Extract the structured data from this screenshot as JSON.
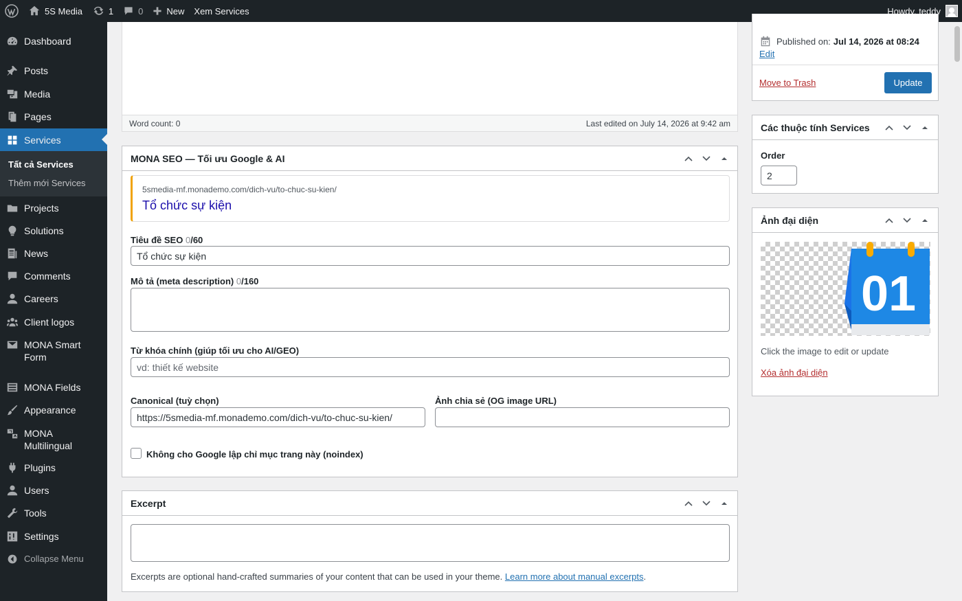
{
  "adminbar": {
    "site_name": "5S Media",
    "updates_count": "1",
    "comments_count": "0",
    "new_label": "New",
    "view_label": "Xem Services",
    "howdy": "Howdy, teddy"
  },
  "sidebar": {
    "items": [
      {
        "label": "Dashboard",
        "icon": "dashboard-icon"
      },
      {
        "label": "Posts",
        "icon": "pin-icon"
      },
      {
        "label": "Media",
        "icon": "media-icon"
      },
      {
        "label": "Pages",
        "icon": "pages-icon"
      },
      {
        "label": "Services",
        "icon": "grid-icon"
      },
      {
        "label": "Projects",
        "icon": "folder-icon"
      },
      {
        "label": "Solutions",
        "icon": "lightbulb-icon"
      },
      {
        "label": "News",
        "icon": "news-icon"
      },
      {
        "label": "Comments",
        "icon": "comment-icon"
      },
      {
        "label": "Careers",
        "icon": "user-icon"
      },
      {
        "label": "Client logos",
        "icon": "groups-icon"
      },
      {
        "label": "MONA Smart Form",
        "icon": "email-icon"
      },
      {
        "label": "MONA Fields",
        "icon": "list-icon"
      },
      {
        "label": "Appearance",
        "icon": "brush-icon"
      },
      {
        "label": "MONA Multilingual",
        "icon": "translate-icon"
      },
      {
        "label": "Plugins",
        "icon": "plugin-icon"
      },
      {
        "label": "Users",
        "icon": "users-icon"
      },
      {
        "label": "Tools",
        "icon": "wrench-icon"
      },
      {
        "label": "Settings",
        "icon": "settings-icon"
      },
      {
        "label": "Collapse Menu",
        "icon": "collapse-icon"
      }
    ],
    "submenu": {
      "all": "Tất cả Services",
      "add": "Thêm mới Services"
    }
  },
  "editor": {
    "word_count": "Word count: 0",
    "last_edited": "Last edited on July 14, 2026 at 9:42 am"
  },
  "seo": {
    "title": "MONA SEO — Tối ưu Google & AI",
    "preview_url": "5smedia-mf.monademo.com/dich-vu/to-chuc-su-kien/",
    "preview_title": "Tổ chức sự kiện",
    "seo_title_label": "Tiêu đề SEO",
    "seo_title_count": "0",
    "seo_title_max": "/60",
    "seo_title_value": "Tổ chức sự kiện",
    "meta_label": "Mô tả (meta description)",
    "meta_count": "0",
    "meta_max": "/160",
    "meta_value": "",
    "keyword_label": "Từ khóa chính (giúp tối ưu cho AI/GEO)",
    "keyword_placeholder": "vd: thiết kế website",
    "canonical_label": "Canonical (tuỳ chọn)",
    "canonical_value": "https://5smedia-mf.monademo.com/dich-vu/to-chuc-su-kien/",
    "og_label": "Ảnh chia sẻ (OG image URL)",
    "og_value": "",
    "noindex_label": "Không cho Google lập chỉ mục trang này (noindex)"
  },
  "excerpt": {
    "title": "Excerpt",
    "help": "Excerpts are optional hand-crafted summaries of your content that can be used in your theme.",
    "link": "Learn more about manual excerpts",
    "period": "."
  },
  "publish": {
    "published_label": "Published on:",
    "published_value": "Jul 14, 2026 at 08:24",
    "edit": "Edit",
    "trash": "Move to Trash",
    "update": "Update"
  },
  "attributes": {
    "title": "Các thuộc tính Services",
    "order_label": "Order",
    "order_value": "2"
  },
  "thumbnail": {
    "title": "Ảnh đại diện",
    "calendar_number": "01",
    "hint": "Click the image to edit or update",
    "remove": "Xóa ảnh đại diện"
  }
}
